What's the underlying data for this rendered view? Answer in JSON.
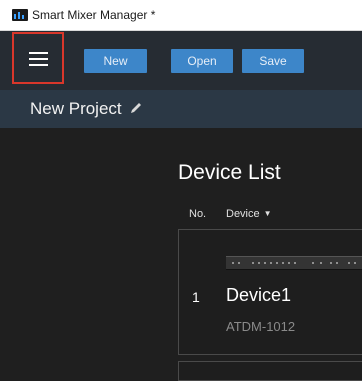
{
  "window": {
    "title": "Smart Mixer Manager *"
  },
  "toolbar": {
    "menu_icon": "hamburger-menu-icon",
    "new_label": "New",
    "open_label": "Open",
    "save_label": "Save"
  },
  "project": {
    "name": "New Project",
    "edit_icon": "pencil-icon"
  },
  "device_list": {
    "title": "Device List",
    "columns": {
      "no": "No.",
      "device": "Device"
    },
    "sort_icon": "caret-down-icon",
    "rows": [
      {
        "no": "1",
        "name": "Device1",
        "model": "ATDM-1012"
      }
    ]
  },
  "colors": {
    "toolbar_bg": "#262c33",
    "project_bar_bg": "#2b3845",
    "button_blue": "#3d86c9",
    "highlight_red": "#d9372b",
    "content_bg": "#1f1f1f"
  }
}
